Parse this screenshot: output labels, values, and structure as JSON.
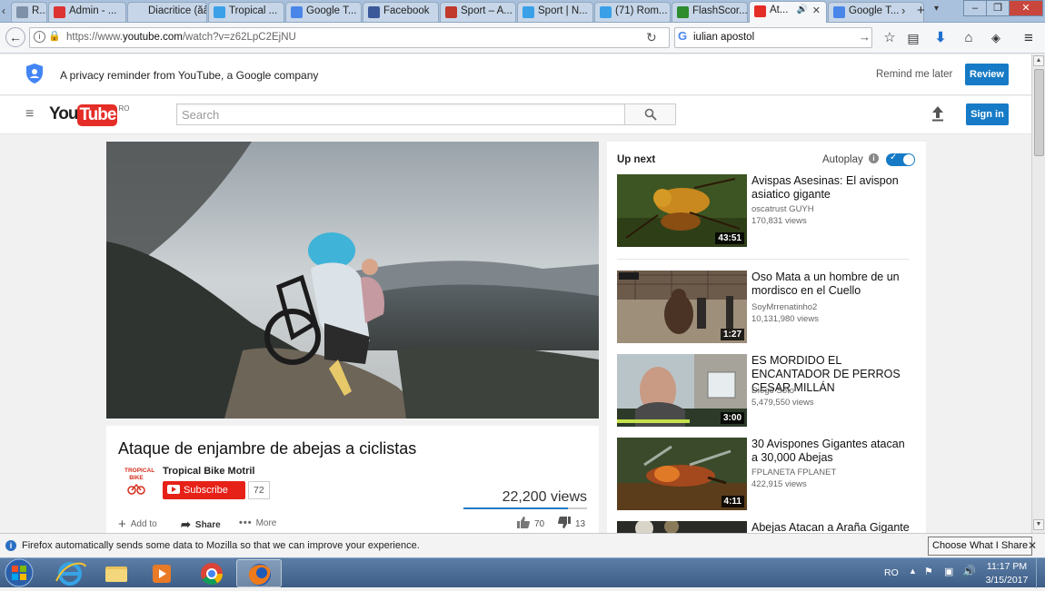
{
  "browser": {
    "tabs": [
      {
        "label": "R...",
        "icon": "page-icon",
        "color": "#7e8fa8"
      },
      {
        "label": "Admin - ...",
        "icon": "r-icon",
        "color": "#d33"
      },
      {
        "label": "Diacritice (ăâî...",
        "icon": "page-icon",
        "color": "#c6d6e8"
      },
      {
        "label": "Tropical ...",
        "icon": "twitter-icon",
        "color": "#3aa0e8"
      },
      {
        "label": "Google T...",
        "icon": "google-translate-icon",
        "color": "#4a86e8"
      },
      {
        "label": "Facebook",
        "icon": "facebook-icon",
        "color": "#3b5998"
      },
      {
        "label": "Sport – A...",
        "icon": "sport-icon",
        "color": "#c0392b"
      },
      {
        "label": "Sport | N...",
        "icon": "twitter-icon",
        "color": "#3aa0e8"
      },
      {
        "label": "(71) Rom...",
        "icon": "twitter-icon",
        "color": "#3aa0e8"
      },
      {
        "label": "FlashScor...",
        "icon": "flashscore-icon",
        "color": "#2e8b2e"
      },
      {
        "label": "At...",
        "icon": "youtube-icon",
        "color": "#e52d27"
      },
      {
        "label": "Google T...",
        "icon": "google-translate-icon",
        "color": "#4a86e8"
      }
    ],
    "url_prefix": "https://www.",
    "url_domain": "youtube.com",
    "url_path": "/watch?v=z62LpC2EjNU",
    "search_value": "iulian apostol"
  },
  "privacy": {
    "text": "A privacy reminder from YouTube, a Google company",
    "remind_label": "Remind me later",
    "review_label": "Review"
  },
  "youtube": {
    "logo_you": "You",
    "logo_tube": "Tube",
    "region": "RO",
    "search_placeholder": "Search",
    "signin_label": "Sign in"
  },
  "video": {
    "title": "Ataque de enjambre de abejas a ciclistas",
    "channel": "Tropical Bike Motril",
    "channel_logo_text": "TROPICAL BIKE",
    "subscribe_label": "Subscribe",
    "subscriber_count": "72",
    "views": "22,200 views",
    "add_to_label": "Add to",
    "share_label": "Share",
    "more_label": "More",
    "likes": "70",
    "dislikes": "13"
  },
  "sidebar": {
    "up_next_label": "Up next",
    "autoplay_label": "Autoplay",
    "autoplay_on": true,
    "items": [
      {
        "title": "Avispas Asesinas: El avispon asiatico gigante",
        "channel": "oscatrust GUYH",
        "views": "170,831 views",
        "duration": "43:51"
      },
      {
        "title": "Oso Mata a un hombre de un mordisco en el Cuello",
        "channel": "SoyMrrenatinho2",
        "views": "10,131,980 views",
        "duration": "1:27"
      },
      {
        "title": "ES MORDIDO EL ENCANTADOR DE PERROS CESAR MILLÁN",
        "channel": "Diego Soto",
        "views": "5,479,550 views",
        "duration": "3:00"
      },
      {
        "title": "30 Avispones Gigantes atacan a 30,000 Abejas",
        "channel": "FPLANETA FPLANET",
        "views": "422,915 views",
        "duration": "4:11"
      },
      {
        "title": "Abejas Atacan a Araña Gigante ||",
        "channel": "",
        "views": "",
        "duration": ""
      }
    ]
  },
  "notification": {
    "text": "Firefox automatically sends some data to Mozilla so that we can improve your experience.",
    "button_label": "Choose What I Share"
  },
  "taskbar": {
    "lang": "RO",
    "time": "11:17 PM",
    "date": "3/15/2017"
  }
}
